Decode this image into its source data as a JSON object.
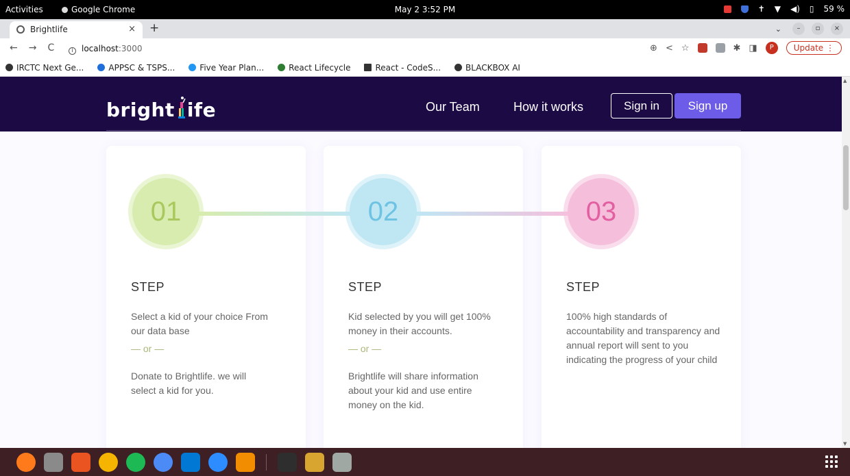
{
  "system": {
    "activities": "Activities",
    "app_name": "Google Chrome",
    "clock": "May 2  3:52 PM",
    "battery": "59 %"
  },
  "browser": {
    "tab_title": "Brightlife",
    "url_host": "localhost",
    "url_port": ":3000",
    "update_label": "Update",
    "avatar_letter": "P",
    "bookmarks": [
      {
        "label": "IRCTC Next Ge...",
        "icon": "globe-icon",
        "color": "#333333"
      },
      {
        "label": "APPSC & TSPS...",
        "icon": "funnel-icon",
        "color": "#1e6fd9"
      },
      {
        "label": "Five Year Plan...",
        "icon": "upload-circle-icon",
        "color": "#2196f3"
      },
      {
        "label": "React Lifecycle",
        "icon": "w-logo-icon",
        "color": "#2e7d32"
      },
      {
        "label": "React - CodeS...",
        "icon": "square-icon",
        "color": "#333333"
      },
      {
        "label": "BLACKBOX AI",
        "icon": "globe-icon",
        "color": "#333333"
      }
    ]
  },
  "site": {
    "logo_left": "bright",
    "logo_right": "ife",
    "nav": {
      "our_team": "Our Team",
      "how_it_works": "How it works",
      "sign_in": "Sign in",
      "sign_up": "Sign up"
    },
    "brand_colors": {
      "nav_bg": "#1c0a45",
      "signup_bg": "#6c5ce7"
    },
    "steps": [
      {
        "number": "01",
        "label": "STEP",
        "text1": "Select a kid of your choice From our data base",
        "or": "— or —",
        "text2": "Donate to Brightlife. we will select a kid for you.",
        "circle_color": "#d7ecae",
        "number_color": "#a9c85e"
      },
      {
        "number": "02",
        "label": "STEP",
        "text1": "Kid selected by you will get 100% money in their accounts.",
        "or": "— or —",
        "text2": "Brightlife will share information about your kid and use entire money on the kid.",
        "circle_color": "#bfe6f3",
        "number_color": "#6ec3e3"
      },
      {
        "number": "03",
        "label": "STEP",
        "text1": "100% high standards of accountability and transparency and annual report will sent to you indicating the progress of your child",
        "or": "",
        "text2": "",
        "circle_color": "#f5bfdc",
        "number_color": "#e25fa2"
      }
    ]
  },
  "dock": {
    "apps": [
      {
        "name": "firefox-icon",
        "color": "#ff7a1a"
      },
      {
        "name": "files-icon",
        "color": "#8a8a8a"
      },
      {
        "name": "app-center-icon",
        "color": "#e95420"
      },
      {
        "name": "chrome-icon",
        "color": "#f4b400"
      },
      {
        "name": "spotify-icon",
        "color": "#1db954"
      },
      {
        "name": "chromium-icon",
        "color": "#4c8bf5"
      },
      {
        "name": "vscode-icon",
        "color": "#0078d4"
      },
      {
        "name": "zoom-icon",
        "color": "#2d8cff"
      },
      {
        "name": "vlc-icon",
        "color": "#f28c00"
      },
      {
        "name": "terminal-icon",
        "color": "#2e2e2e"
      },
      {
        "name": "impress-icon",
        "color": "#d8a630"
      },
      {
        "name": "trash-icon",
        "color": "#9fa8a3"
      }
    ]
  }
}
